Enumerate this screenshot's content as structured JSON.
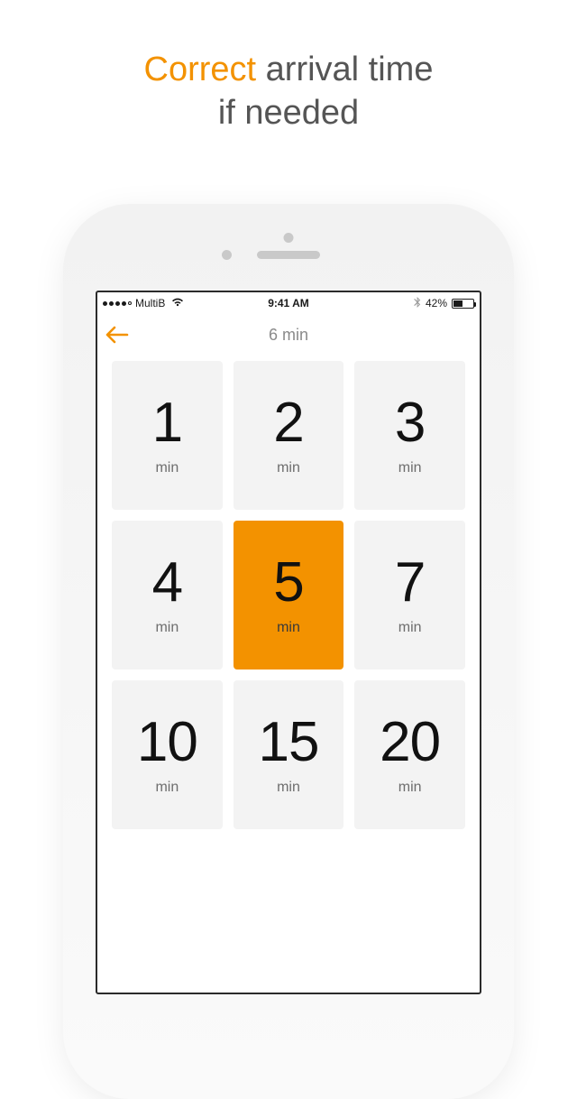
{
  "headline": {
    "accent": "Correct",
    "rest1": " arrival time",
    "rest2": "if needed"
  },
  "status": {
    "carrier": "MultiB",
    "time": "9:41 AM",
    "battery_pct": "42%"
  },
  "nav": {
    "title": "6 min"
  },
  "unit_label": "min",
  "tiles": [
    {
      "value": "1",
      "selected": false
    },
    {
      "value": "2",
      "selected": false
    },
    {
      "value": "3",
      "selected": false
    },
    {
      "value": "4",
      "selected": false
    },
    {
      "value": "5",
      "selected": true
    },
    {
      "value": "7",
      "selected": false
    },
    {
      "value": "10",
      "selected": false
    },
    {
      "value": "15",
      "selected": false
    },
    {
      "value": "20",
      "selected": false
    }
  ],
  "colors": {
    "accent": "#f39200"
  }
}
